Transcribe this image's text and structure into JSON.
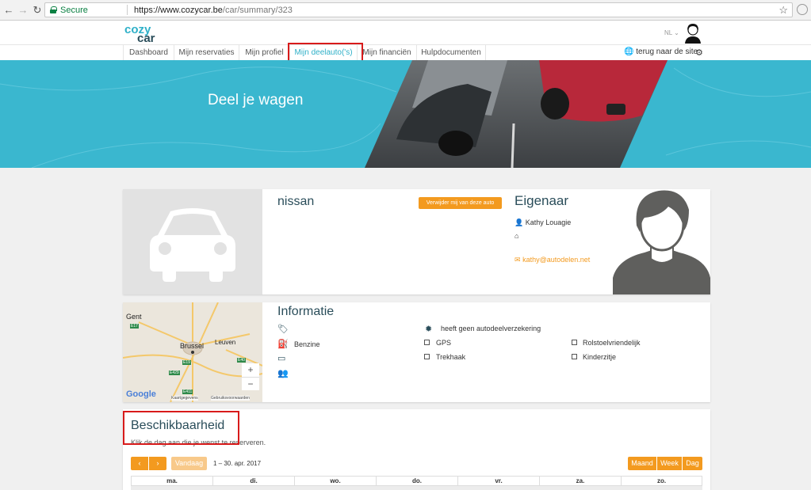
{
  "browser": {
    "secure_label": "Secure",
    "url_host": "https://www.cozycar.be",
    "url_path": "/car/summary/323"
  },
  "site": {
    "logo_line1": "cozy",
    "logo_line2": "car",
    "lang": "NL",
    "site_link": "terug naar de site"
  },
  "menu": {
    "items": [
      {
        "label": "Dashboard"
      },
      {
        "label": "Mijn reservaties"
      },
      {
        "label": "Mijn profiel"
      },
      {
        "label": "Mijn deelauto('s)"
      },
      {
        "label": "Mijn financiën"
      },
      {
        "label": "Hulpdocumenten"
      }
    ]
  },
  "hero": {
    "title": "Deel je wagen"
  },
  "car": {
    "name": "nissan",
    "remove_label": "Verwijder mij van deze auto",
    "owner_heading": "Eigenaar",
    "owner_name": "Kathy Louagie",
    "owner_email": "kathy@autodelen.net"
  },
  "info": {
    "heading": "Informatie",
    "fuel": "Benzine",
    "insurance": "heeft geen autodeelverzekering",
    "options": [
      {
        "label": "GPS",
        "checked": false
      },
      {
        "label": "Rolstoelvriendelijk",
        "checked": false
      },
      {
        "label": "Trekhaak",
        "checked": false
      },
      {
        "label": "Kinderzitje",
        "checked": false
      }
    ]
  },
  "map": {
    "labels": [
      "Gent",
      "Brussel",
      "Leuven",
      "E17",
      "E40",
      "E19",
      "E429",
      "E411"
    ],
    "zoom_in": "+",
    "zoom_out": "−",
    "google": "Google",
    "attribution": "Kaartgegevens",
    "terms": "Gebruiksvoorwaarden"
  },
  "availability": {
    "heading": "Beschikbaarheid",
    "subtitle": "Klik de dag aan die je wenst te reserveren.",
    "prev": "‹",
    "next": "›",
    "today": "Vandaag",
    "range": "1 – 30. apr. 2017",
    "views": [
      "Maand",
      "Week",
      "Dag"
    ],
    "weekdays": [
      "ma.",
      "di.",
      "wo.",
      "do.",
      "vr.",
      "za.",
      "zo."
    ]
  },
  "colors": {
    "accent": "#2fb0c8",
    "orange": "#f39a1f",
    "dark": "#2a4d5a",
    "annotation_red": "#d81b1b"
  }
}
